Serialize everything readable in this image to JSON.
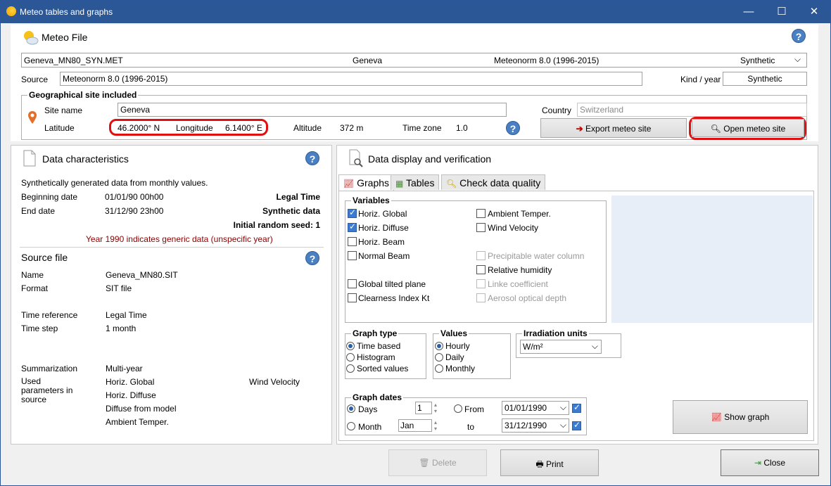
{
  "window": {
    "title": "Meteo tables and graphs",
    "min": "—",
    "max": "☐",
    "close": "✕"
  },
  "meteo_file": {
    "heading": "Meteo File",
    "file_name": "Geneva_MN80_SYN.MET",
    "site": "Geneva",
    "source_db": "Meteonorm 8.0 (1996-2015)",
    "kind": "Synthetic",
    "source_label": "Source",
    "source_value": "Meteonorm 8.0 (1996-2015)",
    "kind_label": "Kind / year",
    "kind_value": "Synthetic"
  },
  "geo": {
    "heading": "Geographical site included",
    "site_name_label": "Site name",
    "site_name": "Geneva",
    "country_label": "Country",
    "country": "Switzerland",
    "latitude_label": "Latitude",
    "latitude": "46.2000° N",
    "longitude_label": "Longitude",
    "longitude": "6.1400° E",
    "altitude_label": "Altitude",
    "altitude": "372 m",
    "timezone_label": "Time zone",
    "timezone": "1.0",
    "export_button": "Export meteo site",
    "open_button": "Open meteo site"
  },
  "data_char": {
    "heading": "Data characteristics",
    "desc": "Synthetically generated data from monthly values.",
    "begin_label": "Beginning date",
    "begin": "01/01/90 00h00",
    "legal_time": "Legal Time",
    "end_label": "End date",
    "end": "31/12/90 23h00",
    "synthetic_data": "Synthetic data",
    "seed": "Initial random seed: 1",
    "note": "Year 1990 indicates generic data (unspecific year)"
  },
  "source_file": {
    "heading": "Source file",
    "name_label": "Name",
    "name": "Geneva_MN80.SIT",
    "format_label": "Format",
    "format": "SIT file",
    "timeref_label": "Time reference",
    "timeref": "Legal Time",
    "timestep_label": "Time step",
    "timestep": "1 month",
    "summ_label": "Summarization",
    "summ": "Multi-year",
    "used_label": "Used parameters in source",
    "params": [
      "Horiz. Global",
      "Horiz. Diffuse",
      "Diffuse from model",
      "Ambient Temper."
    ],
    "params2": "Wind Velocity"
  },
  "display": {
    "heading": "Data display and verification",
    "tabs": [
      "Graphs",
      "Tables",
      "Check data quality"
    ],
    "variables_heading": "Variables",
    "vars_left": [
      "Horiz. Global",
      "Horiz. Diffuse",
      "Horiz. Beam",
      "Normal Beam",
      "Global tilted plane",
      "Clearness Index Kt"
    ],
    "vars_right": [
      "Ambient Temper.",
      "Wind Velocity",
      "Precipitable water column",
      "Relative humidity",
      "Linke coefficient",
      "Aerosol optical depth"
    ],
    "graph_type_heading": "Graph type",
    "graph_types": [
      "Time based",
      "Histogram",
      "Sorted values"
    ],
    "values_heading": "Values",
    "values": [
      "Hourly",
      "Daily",
      "Monthly"
    ],
    "irr_heading": "Irradiation units",
    "irr_value": "W/m²",
    "dates_heading": "Graph dates",
    "days_label": "Days",
    "days_value": "1",
    "month_label": "Month",
    "month_value": "Jan",
    "from_label": "From",
    "from_value": "01/01/1990",
    "to_label": "to",
    "to_value": "31/12/1990",
    "show_graph": "Show graph"
  },
  "bottom": {
    "delete": "Delete",
    "print": "Print",
    "close": "Close"
  }
}
